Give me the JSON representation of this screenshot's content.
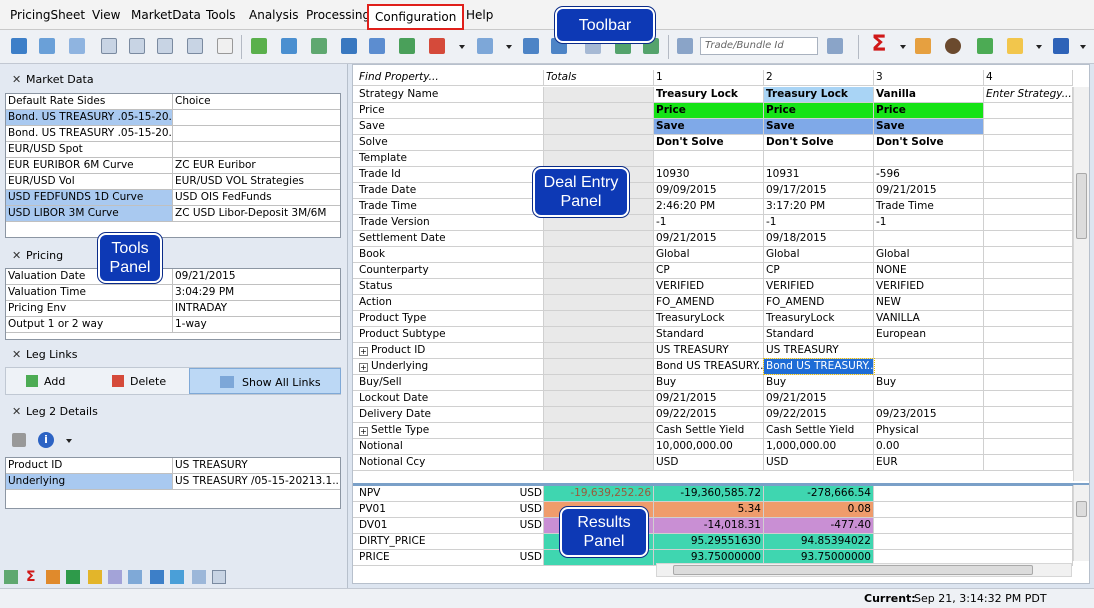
{
  "menu": [
    "PricingSheet",
    "View",
    "MarketData",
    "Tools",
    "Analysis",
    "Processing",
    "Configuration",
    "Help"
  ],
  "toolbar": {
    "search_placeholder": "Trade/Bundle Id"
  },
  "callouts": {
    "toolbar": "Toolbar",
    "deal_entry": "Deal Entry Panel",
    "tools": "Tools Panel",
    "results": "Results Panel"
  },
  "market_data": {
    "title": "Market Data",
    "rows": [
      [
        "Default Rate Sides",
        "Choice"
      ],
      [
        "Bond. US TREASURY .05-15-20...",
        ""
      ],
      [
        "Bond. US TREASURY .05-15-20...",
        ""
      ],
      [
        "EUR/USD Spot",
        ""
      ],
      [
        "EUR EURIBOR 6M Curve",
        "ZC EUR Euribor"
      ],
      [
        "EUR/USD Vol",
        "EUR/USD VOL Strategies"
      ],
      [
        "USD FEDFUNDS 1D Curve",
        "USD OIS FedFunds"
      ],
      [
        "USD LIBOR 3M Curve",
        "ZC USD Libor-Deposit 3M/6M"
      ]
    ]
  },
  "pricing": {
    "title": "Pricing",
    "rows": [
      [
        "Valuation Date",
        "09/21/2015"
      ],
      [
        "Valuation Time",
        "3:04:29 PM"
      ],
      [
        "Pricing Env",
        "INTRADAY"
      ],
      [
        "Output 1 or 2 way",
        "1-way"
      ]
    ]
  },
  "leg_links": {
    "title": "Leg Links",
    "add": "Add",
    "delete": "Delete",
    "show_all": "Show All Links"
  },
  "leg2": {
    "title": "Leg 2 Details",
    "rows": [
      [
        "Product ID",
        "US TREASURY"
      ],
      [
        "Underlying",
        "US TREASURY /05-15-20213.1..."
      ]
    ]
  },
  "grid": {
    "header": [
      "Find Property...",
      "Totals",
      "1",
      "2",
      "3",
      "4"
    ],
    "rows": [
      [
        "Strategy Name",
        "",
        "Treasury Lock",
        "Treasury Lock",
        "Vanilla",
        "Enter Strategy..."
      ],
      [
        "Price",
        "",
        "Price",
        "Price",
        "Price",
        ""
      ],
      [
        "Save",
        "",
        "Save",
        "Save",
        "Save",
        ""
      ],
      [
        "Solve",
        "",
        "Don't Solve",
        "Don't Solve",
        "Don't Solve",
        ""
      ],
      [
        "Template",
        "",
        "",
        "",
        "",
        ""
      ],
      [
        "Trade Id",
        "",
        "10930",
        "10931",
        "-596",
        ""
      ],
      [
        "Trade Date",
        "",
        "09/09/2015",
        "09/17/2015",
        "09/21/2015",
        ""
      ],
      [
        "Trade Time",
        "",
        "2:46:20 PM",
        "3:17:20 PM",
        "Trade Time",
        ""
      ],
      [
        "Trade Version",
        "",
        "-1",
        "-1",
        "-1",
        ""
      ],
      [
        "Settlement Date",
        "",
        "09/21/2015",
        "09/18/2015",
        "",
        ""
      ],
      [
        "Book",
        "",
        "Global",
        "Global",
        "Global",
        ""
      ],
      [
        "Counterparty",
        "",
        "CP",
        "CP",
        "NONE",
        ""
      ],
      [
        "Status",
        "",
        "VERIFIED",
        "VERIFIED",
        "VERIFIED",
        ""
      ],
      [
        "Action",
        "",
        "FO_AMEND",
        "FO_AMEND",
        "NEW",
        ""
      ],
      [
        "Product Type",
        "",
        "TreasuryLock",
        "TreasuryLock",
        "VANILLA",
        ""
      ],
      [
        "Product Subtype",
        "",
        "Standard",
        "Standard",
        "European",
        ""
      ],
      [
        "Product ID",
        "",
        "US TREASURY",
        "US TREASURY",
        "",
        ""
      ],
      [
        "Underlying",
        "",
        "Bond US TREASURY...",
        "Bond US TREASURY...",
        "",
        ""
      ],
      [
        "Buy/Sell",
        "",
        "Buy",
        "Buy",
        "Buy",
        ""
      ],
      [
        "Lockout Date",
        "",
        "09/21/2015",
        "09/21/2015",
        "",
        ""
      ],
      [
        "Delivery Date",
        "",
        "09/22/2015",
        "09/22/2015",
        "09/23/2015",
        ""
      ],
      [
        "Settle Type",
        "",
        "Cash Settle Yield",
        "Cash Settle Yield",
        "Physical",
        ""
      ],
      [
        "Notional",
        "",
        "10,000,000.00",
        "1,000,000.00",
        "0.00",
        ""
      ],
      [
        "Notional Ccy",
        "",
        "USD",
        "USD",
        "EUR",
        ""
      ]
    ]
  },
  "results": {
    "rows": [
      [
        "NPV",
        "USD",
        "-19,639,252.26",
        "-19,360,585.72",
        "-278,666.54"
      ],
      [
        "PV01",
        "USD",
        "",
        "5.34",
        "0.08"
      ],
      [
        "DV01",
        "USD",
        "",
        "-14,018.31",
        "-477.40"
      ],
      [
        "DIRTY_PRICE",
        "",
        "",
        "95.29551630",
        "94.85394022"
      ],
      [
        "PRICE",
        "USD",
        "",
        "93.75000000",
        "93.75000000"
      ]
    ],
    "colors": {
      "npv": "#3fd6b0",
      "pv01": "#ef9c6b",
      "dv01": "#c98fd4",
      "dirty": "#3fd6b0",
      "price": "#3fd6b0"
    }
  },
  "status": {
    "label": "Current:",
    "value": "Sep 21, 3:14:32 PM PDT"
  }
}
